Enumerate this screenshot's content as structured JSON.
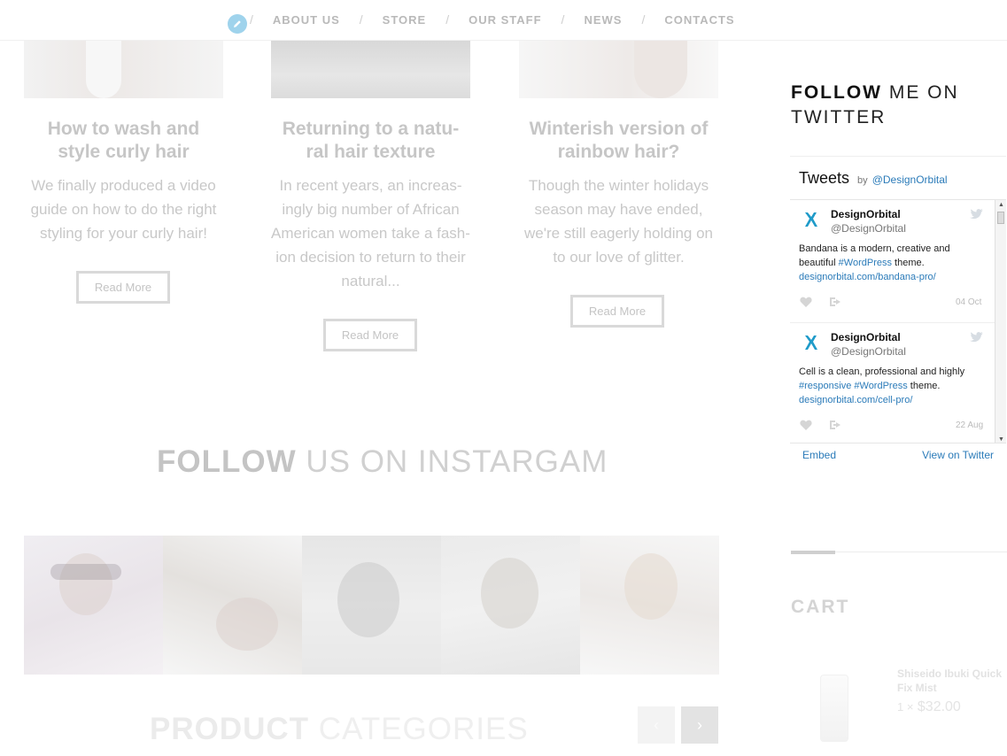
{
  "nav": {
    "items": [
      "ABOUT US",
      "STORE",
      "OUR STAFF",
      "NEWS",
      "CONTACTS"
    ],
    "separator": "/"
  },
  "posts": [
    {
      "title": "How to wash and style curly hair",
      "excerpt": "We finally produced a video guide on how to do the right styling for your curly hair!",
      "button": "Read More"
    },
    {
      "title": "Returning to a natu-ral hair texture",
      "excerpt": "In recent years, an increas-ingly big number of African American women take a fash-ion decision to return to their natural...",
      "button": "Read More"
    },
    {
      "title": "Winterish version of rainbow hair?",
      "excerpt": "Though the winter holidays season may have ended, we're still eagerly holding on to our love of glitter.",
      "button": "Read More"
    }
  ],
  "instagram": {
    "heading_bold": "FOLLOW",
    "heading_light": "US ON INSTARGAM"
  },
  "categories": {
    "heading_bold": "PRODUCT",
    "heading_light": "CATEGORIES",
    "prev": "‹",
    "next": "›"
  },
  "sidebar": {
    "twitter_title_bold": "FOLLOW",
    "twitter_title_rest_1": "ME ON",
    "twitter_title_rest_2": "TWITTER",
    "widget": {
      "header": "Tweets",
      "by": "by",
      "handle": "@DesignOrbital",
      "tweets": [
        {
          "name": "DesignOrbital",
          "user": "@DesignOrbital",
          "text_1": "Bandana is a modern, creative and beautiful",
          "tag": "#WordPress",
          "text_2": "theme.",
          "link": "designorbital.com/bandana-pro/",
          "date": "04 Oct"
        },
        {
          "name": "DesignOrbital",
          "user": "@DesignOrbital",
          "text_1": "Cell is a clean, professional and highly",
          "tag_a": "#responsive",
          "tag": "#WordPress",
          "text_2": "theme.",
          "link": "designorbital.com/cell-pro/",
          "date": "22 Aug"
        }
      ],
      "embed": "Embed",
      "view": "View on Twitter"
    },
    "cart": {
      "title": "CART",
      "item_name": "Shiseido Ibuki Quick Fix Mist",
      "qty": "1 ×",
      "price": "$32.00"
    }
  },
  "colors": {
    "accent": "#9fd3ec",
    "twitter_link": "#2b7bb9",
    "logo": "#1f9bc9"
  }
}
